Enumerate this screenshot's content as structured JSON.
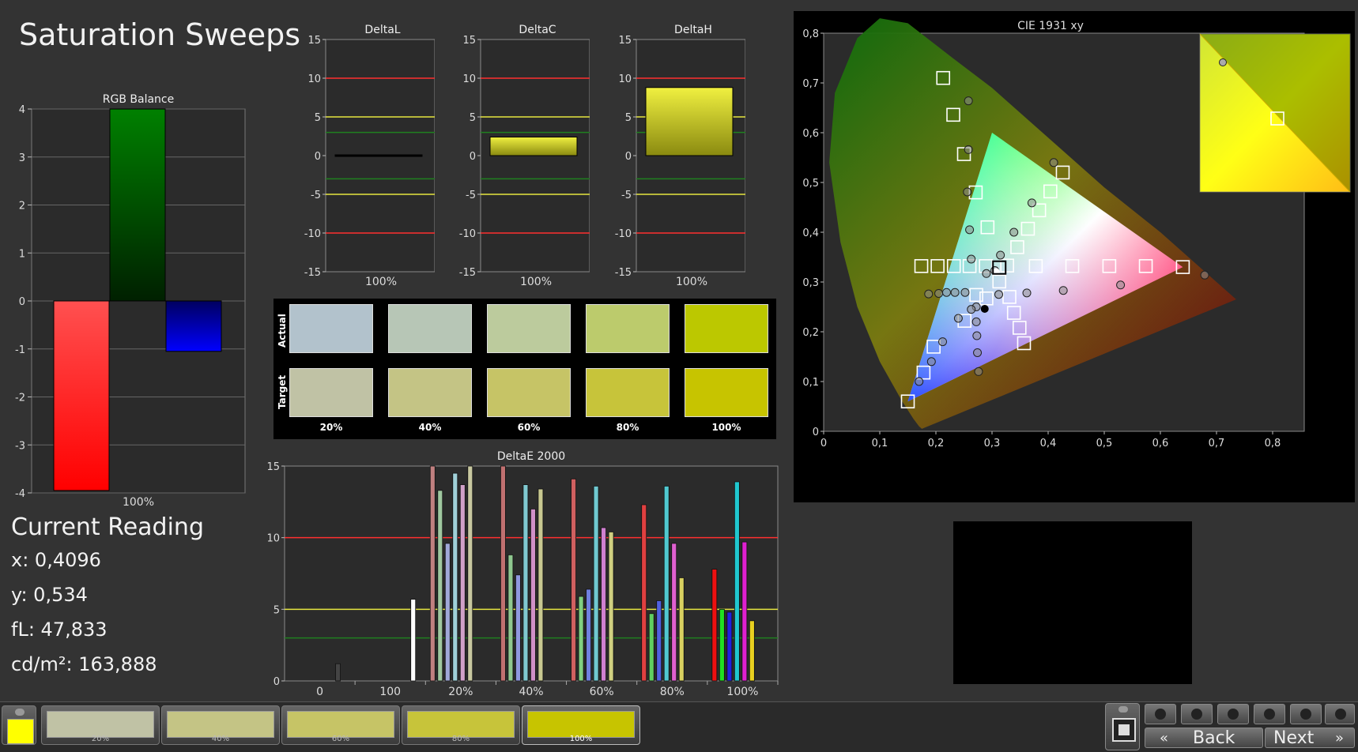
{
  "title": "Saturation Sweeps",
  "rgb_balance": {
    "title": "RGB Balance",
    "category": "100%",
    "ticks": [
      "4",
      "3",
      "2",
      "1",
      "0",
      "-1",
      "-2",
      "-3",
      "-4"
    ]
  },
  "delta_charts": {
    "ticks": [
      "15",
      "10",
      "5",
      "0",
      "-5",
      "-10",
      "-15"
    ],
    "category": "100%",
    "titles": [
      "DeltaL",
      "DeltaC",
      "DeltaH"
    ]
  },
  "swatches": {
    "actual_label": "Actual",
    "target_label": "Target",
    "labels": [
      "20%",
      "40%",
      "60%",
      "80%",
      "100%"
    ],
    "actual_colors": [
      "#b2c2cc",
      "#b7c6b6",
      "#bccb9d",
      "#bccb6c",
      "#bcc800"
    ],
    "target_colors": [
      "#c0c2a5",
      "#c4c485",
      "#c6c466",
      "#c7c43a",
      "#c7c400"
    ]
  },
  "deltae": {
    "title": "DeltaE 2000",
    "ticks": [
      "15",
      "10",
      "5",
      "0"
    ],
    "categories": [
      "0",
      "100",
      "20%",
      "40%",
      "60%",
      "80%",
      "100%"
    ]
  },
  "cie": {
    "title": "CIE 1931 xy",
    "x_ticks": [
      "0",
      "0,1",
      "0,2",
      "0,3",
      "0,4",
      "0,5",
      "0,6",
      "0,7",
      "0,8"
    ],
    "y_ticks": [
      "0",
      "0,1",
      "0,2",
      "0,3",
      "0,4",
      "0,5",
      "0,6",
      "0,7",
      "0,8"
    ]
  },
  "current_reading": {
    "heading": "Current Reading",
    "x": "x: 0,4096",
    "y": "y: 0,534",
    "fl": "fL: 47,833",
    "cdm2": "cd/m²: 163,888"
  },
  "patch_buttons": [
    {
      "label": "20%",
      "color": "#c0c2a5"
    },
    {
      "label": "40%",
      "color": "#c4c485"
    },
    {
      "label": "60%",
      "color": "#c6c466"
    },
    {
      "label": "80%",
      "color": "#c7c43a"
    },
    {
      "label": "100%",
      "color": "#c7c400"
    }
  ],
  "current_color": "#ffff00",
  "nav": {
    "back": "Back",
    "next": "Next"
  },
  "chart_data": [
    {
      "type": "bar",
      "title": "RGB Balance",
      "categories": [
        "100%"
      ],
      "series": [
        {
          "name": "Red",
          "values": [
            -3.95
          ],
          "color": "#ff2020"
        },
        {
          "name": "Green",
          "values": [
            4.0
          ],
          "color": "#008000"
        },
        {
          "name": "Blue",
          "values": [
            -1.05
          ],
          "color": "#0000ff"
        }
      ],
      "ylim": [
        -4,
        4
      ]
    },
    {
      "type": "bar",
      "title": "DeltaL",
      "categories": [
        "100%"
      ],
      "values": [
        0.1
      ],
      "ylim": [
        -15,
        15
      ]
    },
    {
      "type": "bar",
      "title": "DeltaC",
      "categories": [
        "100%"
      ],
      "values": [
        2.4
      ],
      "ylim": [
        -15,
        15
      ]
    },
    {
      "type": "bar",
      "title": "DeltaH",
      "categories": [
        "100%"
      ],
      "values": [
        8.8
      ],
      "ylim": [
        -15,
        15
      ]
    },
    {
      "type": "bar",
      "title": "DeltaE 2000",
      "categories": [
        "0",
        "100",
        "20%",
        "40%",
        "60%",
        "80%",
        "100%"
      ],
      "groups": [
        {
          "category": "0",
          "bars": [
            {
              "v": 1.2,
              "c": "#444444"
            }
          ]
        },
        {
          "category": "100",
          "bars": [
            {
              "v": 5.7,
              "c": "#ffffff"
            }
          ]
        },
        {
          "category": "20%",
          "bars": [
            {
              "v": 15,
              "c": "#c08080"
            },
            {
              "v": 13.3,
              "c": "#a0c8a0"
            },
            {
              "v": 9.6,
              "c": "#a0a8d8"
            },
            {
              "v": 14.5,
              "c": "#a0d0d8"
            },
            {
              "v": 13.7,
              "c": "#d0a0c8"
            },
            {
              "v": 15,
              "c": "#c8c8a0"
            }
          ]
        },
        {
          "category": "40%",
          "bars": [
            {
              "v": 15,
              "c": "#c07070"
            },
            {
              "v": 8.8,
              "c": "#90c890"
            },
            {
              "v": 7.4,
              "c": "#9098e0"
            },
            {
              "v": 13.7,
              "c": "#80c8d0"
            },
            {
              "v": 12.0,
              "c": "#d090c8"
            },
            {
              "v": 13.4,
              "c": "#c8c890"
            }
          ]
        },
        {
          "category": "60%",
          "bars": [
            {
              "v": 14.1,
              "c": "#d06060"
            },
            {
              "v": 5.9,
              "c": "#80d080"
            },
            {
              "v": 6.4,
              "c": "#7080e0"
            },
            {
              "v": 13.6,
              "c": "#70c8d0"
            },
            {
              "v": 10.7,
              "c": "#d080d0"
            },
            {
              "v": 10.4,
              "c": "#d0d080"
            }
          ]
        },
        {
          "category": "80%",
          "bars": [
            {
              "v": 12.3,
              "c": "#e04040"
            },
            {
              "v": 4.7,
              "c": "#60d060"
            },
            {
              "v": 5.6,
              "c": "#5060e0"
            },
            {
              "v": 13.6,
              "c": "#50c8d0"
            },
            {
              "v": 9.6,
              "c": "#e060d0"
            },
            {
              "v": 7.2,
              "c": "#d8d060"
            }
          ]
        },
        {
          "category": "100%",
          "bars": [
            {
              "v": 7.8,
              "c": "#ee1010"
            },
            {
              "v": 5.0,
              "c": "#20e020"
            },
            {
              "v": 4.8,
              "c": "#2020e0"
            },
            {
              "v": 13.9,
              "c": "#20c8d0"
            },
            {
              "v": 9.7,
              "c": "#e020d0"
            },
            {
              "v": 4.2,
              "c": "#e8d020"
            }
          ]
        }
      ],
      "reference_lines": [
        10,
        5,
        3
      ],
      "ylim": [
        0,
        15
      ]
    },
    {
      "type": "scatter",
      "title": "CIE 1931 xy",
      "xlim": [
        0,
        0.8
      ],
      "ylim": [
        0,
        0.8
      ],
      "gamut_triangle": [
        [
          0.64,
          0.33
        ],
        [
          0.3,
          0.6
        ],
        [
          0.15,
          0.06
        ]
      ],
      "target_squares": [
        [
          0.213,
          0.71
        ],
        [
          0.231,
          0.636
        ],
        [
          0.25,
          0.557
        ],
        [
          0.271,
          0.48
        ],
        [
          0.292,
          0.41
        ],
        [
          0.426,
          0.52
        ],
        [
          0.404,
          0.482
        ],
        [
          0.384,
          0.444
        ],
        [
          0.364,
          0.407
        ],
        [
          0.345,
          0.37
        ],
        [
          0.327,
          0.333
        ],
        [
          0.174,
          0.332
        ],
        [
          0.203,
          0.332
        ],
        [
          0.232,
          0.332
        ],
        [
          0.26,
          0.332
        ],
        [
          0.289,
          0.332
        ],
        [
          0.313,
          0.329
        ],
        [
          0.378,
          0.332
        ],
        [
          0.443,
          0.332
        ],
        [
          0.509,
          0.332
        ],
        [
          0.574,
          0.332
        ],
        [
          0.64,
          0.33
        ],
        [
          0.178,
          0.118
        ],
        [
          0.196,
          0.17
        ],
        [
          0.251,
          0.222
        ],
        [
          0.272,
          0.274
        ],
        [
          0.29,
          0.267
        ],
        [
          0.313,
          0.301
        ],
        [
          0.331,
          0.27
        ],
        [
          0.339,
          0.238
        ],
        [
          0.349,
          0.208
        ],
        [
          0.357,
          0.177
        ],
        [
          0.15,
          0.06
        ]
      ],
      "measured_points": [
        [
          0.258,
          0.664
        ],
        [
          0.258,
          0.566
        ],
        [
          0.256,
          0.481
        ],
        [
          0.26,
          0.405
        ],
        [
          0.263,
          0.346
        ],
        [
          0.41,
          0.54
        ],
        [
          0.371,
          0.459
        ],
        [
          0.339,
          0.4
        ],
        [
          0.315,
          0.354
        ],
        [
          0.29,
          0.317
        ],
        [
          0.305,
          0.323
        ],
        [
          0.187,
          0.276
        ],
        [
          0.205,
          0.277
        ],
        [
          0.219,
          0.279
        ],
        [
          0.234,
          0.279
        ],
        [
          0.252,
          0.279
        ],
        [
          0.679,
          0.314
        ],
        [
          0.529,
          0.294
        ],
        [
          0.427,
          0.283
        ],
        [
          0.362,
          0.278
        ],
        [
          0.312,
          0.275
        ],
        [
          0.272,
          0.25
        ],
        [
          0.272,
          0.22
        ],
        [
          0.273,
          0.192
        ],
        [
          0.274,
          0.158
        ],
        [
          0.276,
          0.12
        ],
        [
          0.24,
          0.227
        ],
        [
          0.212,
          0.18
        ],
        [
          0.192,
          0.14
        ],
        [
          0.17,
          0.1
        ],
        [
          0.263,
          0.245
        ]
      ],
      "current_point": [
        0.4096,
        0.534
      ]
    }
  ]
}
